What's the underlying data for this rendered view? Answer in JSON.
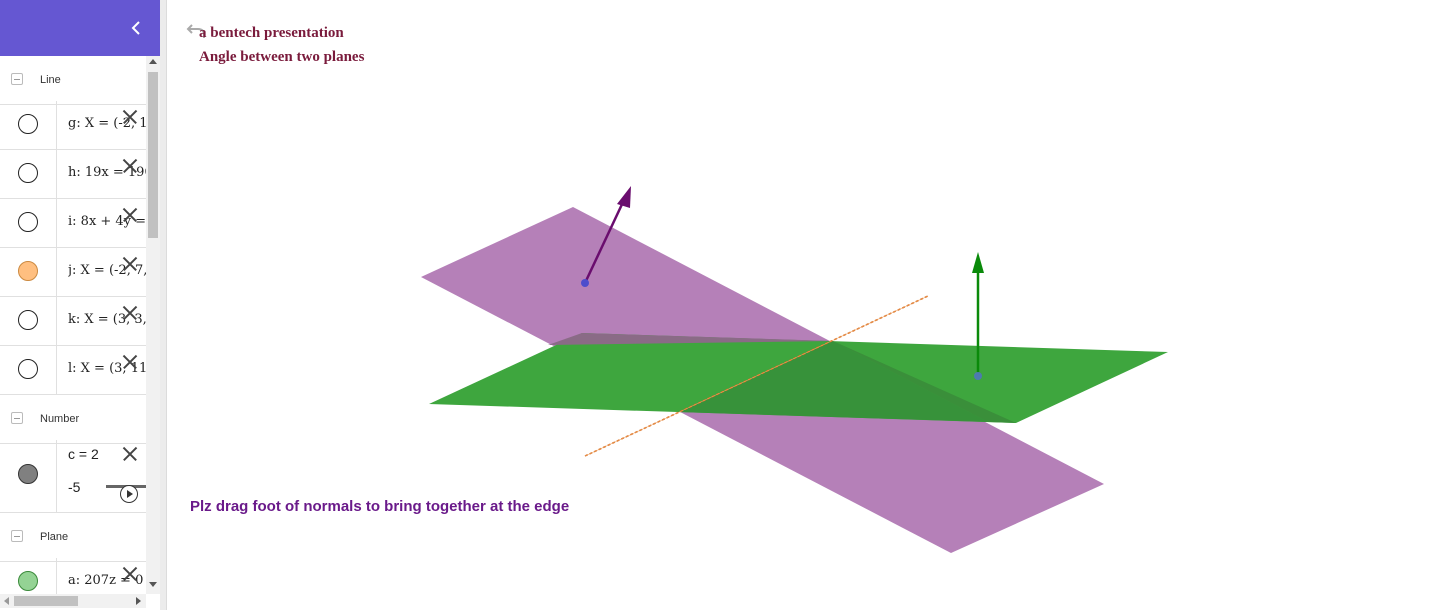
{
  "algebra": {
    "collapse_icon": "chevron-left-icon",
    "groups": [
      {
        "label": "Line"
      },
      {
        "label": "Number"
      },
      {
        "label": "Plane"
      }
    ],
    "lines": [
      {
        "expr": "g: X = (-2, 1",
        "marble_color": "#ffffff"
      },
      {
        "expr": "h: 19x = 190",
        "marble_color": "#ffffff"
      },
      {
        "expr": "i: 8x + 4y =",
        "marble_color": "#ffffff"
      },
      {
        "expr": "j: X = (-2, 7,",
        "marble_color": "#ffbf80"
      },
      {
        "expr": "k: X = (3, 3,",
        "marble_color": "#ffffff"
      },
      {
        "expr": "l: X = (3, 11",
        "marble_color": "#ffffff"
      }
    ],
    "number": {
      "expr": "c = 2",
      "slider_min": "-5",
      "marble_color": "#808080"
    },
    "plane": {
      "expr": "a: 207z = 0",
      "marble_color": "#94d394"
    }
  },
  "graphics": {
    "title_line1": "a bentech presentation",
    "title_line2": "Angle between two planes",
    "instruction": "Plz drag foot of normals to bring together at the edge",
    "colors": {
      "purple_plane": "#b580b8",
      "green_plane": "#3ea63e",
      "overlap": "#8a6b86",
      "purple_normal": "#6a0d6e",
      "green_normal": "#0a8a0a",
      "edge_line": "#d2691e",
      "foot_point": "#4d4dcc"
    }
  }
}
